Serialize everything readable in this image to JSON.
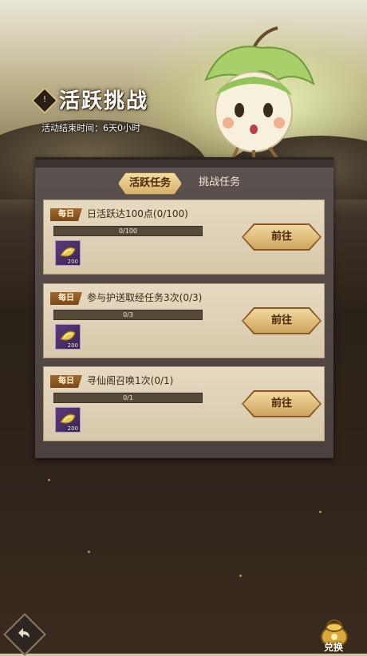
{
  "header": {
    "title": "活跃挑战",
    "end_time": "活动结束时间：6天0小时"
  },
  "tabs": [
    {
      "label": "活跃任务",
      "active": true
    },
    {
      "label": "挑战任务",
      "active": false
    }
  ],
  "tasks": [
    {
      "badge": "每日",
      "title": "日活跃达100点(0/100)",
      "progress_text": "0/100",
      "progress": 0,
      "reward_count": "200",
      "button": "前往"
    },
    {
      "badge": "每日",
      "title": "参与护送取经任务3次(0/3)",
      "progress_text": "0/3",
      "progress": 0,
      "reward_count": "200",
      "button": "前往"
    },
    {
      "badge": "每日",
      "title": "寻仙阁召唤1次(0/1)",
      "progress_text": "0/1",
      "progress": 0,
      "reward_count": "200",
      "button": "前往"
    }
  ],
  "footer": {
    "exchange_label": "兑换"
  },
  "colors": {
    "accent_gold": "#d4b16a",
    "panel": "#4a413f",
    "card": "#e6dac2"
  }
}
